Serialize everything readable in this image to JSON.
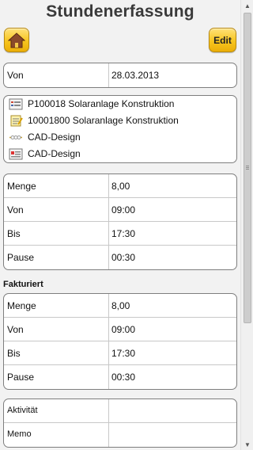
{
  "header": {
    "title": "Stundenerfassung",
    "home_icon": "home-icon",
    "edit_label": "Edit"
  },
  "date_box": {
    "label": "Von",
    "value": "28.03.2013"
  },
  "info_box": {
    "items": [
      {
        "icon": "project-form-icon",
        "text": "P100018 Solaranlage Konstruktion"
      },
      {
        "icon": "task-notepad-icon",
        "text": "10001800 Solaranlage Konstruktion"
      },
      {
        "icon": "activity-chain-icon",
        "text": "CAD-Design"
      },
      {
        "icon": "activity-card-icon",
        "text": "CAD-Design"
      }
    ]
  },
  "times_box": {
    "rows": [
      {
        "label": "Menge",
        "value": "8,00"
      },
      {
        "label": "Von",
        "value": "09:00"
      },
      {
        "label": "Bis",
        "value": "17:30"
      },
      {
        "label": "Pause",
        "value": "00:30"
      }
    ]
  },
  "fakturiert": {
    "title": "Fakturiert",
    "rows": [
      {
        "label": "Menge",
        "value": "8,00"
      },
      {
        "label": "Von",
        "value": "09:00"
      },
      {
        "label": "Bis",
        "value": "17:30"
      },
      {
        "label": "Pause",
        "value": "00:30"
      }
    ]
  },
  "notes_box": {
    "rows": [
      {
        "label": "Aktivität",
        "value": ""
      },
      {
        "label": "Memo",
        "value": ""
      }
    ]
  },
  "colors": {
    "button_gradient_top": "#ffe27a",
    "button_gradient_bottom": "#ebae08",
    "background": "#f2f2f2"
  }
}
